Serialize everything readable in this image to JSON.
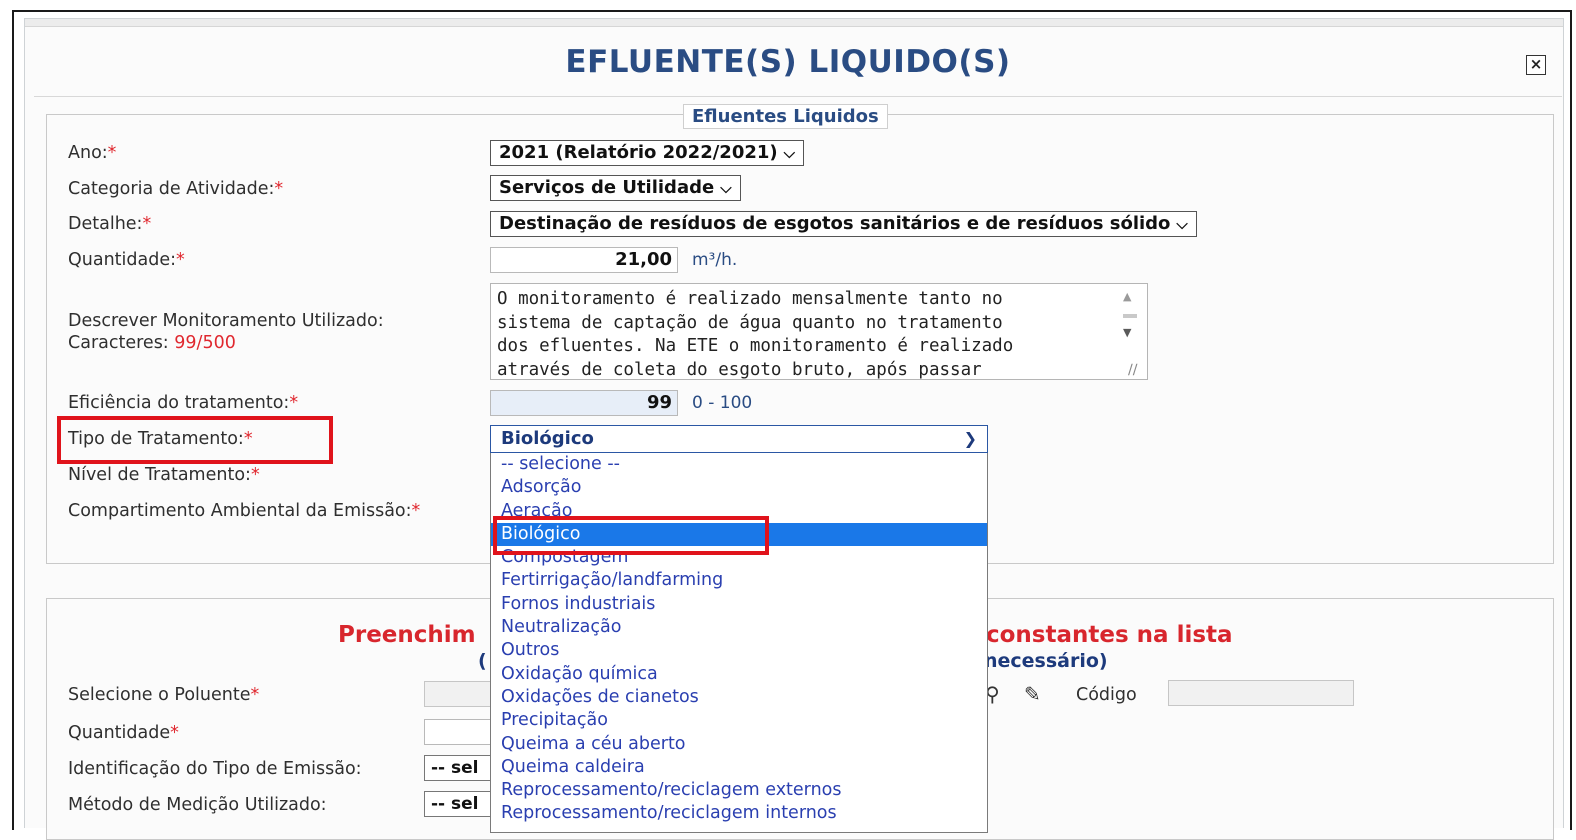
{
  "header": {
    "title": "EFLUENTE(S) LIQUIDO(S)",
    "close_icon": "×"
  },
  "section": {
    "legend": "Efluentes Liquidos",
    "required_mark": "*",
    "ano": {
      "label": "Ano:",
      "value": "2021 (Relatório 2022/2021)"
    },
    "categoria": {
      "label": "Categoria de Atividade:",
      "value": "Serviços de Utilidade"
    },
    "detalhe": {
      "label": "Detalhe:",
      "value": "Destinação de resíduos de esgotos sanitários e de resíduos sólido"
    },
    "quantidade": {
      "label": "Quantidade:",
      "value": "21,00",
      "unit": "m³/h."
    },
    "monitoramento": {
      "label": "Descrever Monitoramento Utilizado:",
      "chars_label": "Caracteres:",
      "chars_value": "99/500",
      "lines": [
        "O monitoramento é realizado mensalmente tanto no",
        "sistema de captação de água quanto no tratamento",
        "dos efluentes. Na ETE o monitoramento é realizado",
        "através de coleta do esgoto bruto, após passar"
      ]
    },
    "eficiencia": {
      "label": "Eficiência do tratamento:",
      "value": "99",
      "range": "0 - 100"
    },
    "tipo_tratamento": {
      "label": "Tipo de Tratamento:",
      "value": "Biológico",
      "options": [
        "-- selecione --",
        "Adsorção",
        "Aeração",
        "Biológico",
        "Compostagem",
        "Fertirrigação/landfarming",
        "Fornos industriais",
        "Neutralização",
        "Outros",
        "Oxidação química",
        "Oxidações de cianetos",
        "Precipitação",
        "Queima a céu aberto",
        "Queima caldeira",
        "Reprocessamento/reciclagem externos",
        "Reprocessamento/reciclagem internos"
      ],
      "selected_index": 3
    },
    "nivel_tratamento": {
      "label": "Nível de Tratamento:"
    },
    "compartimento": {
      "label": "Compartimento Ambiental da Emissão:"
    }
  },
  "pollutants": {
    "title_left": "Preenchim",
    "title_right": "constantes na lista",
    "sub_left": "(",
    "sub_right": "necessário)",
    "poluente_label": "Selecione o Poluente",
    "quantidade_label": "Quantidade",
    "codigo_label": "Código",
    "tipo_emissao_label": "Identificação do Tipo de Emissão:",
    "metodo_label": "Método de Medição Utilizado:",
    "select_placeholder": "-- sel"
  }
}
